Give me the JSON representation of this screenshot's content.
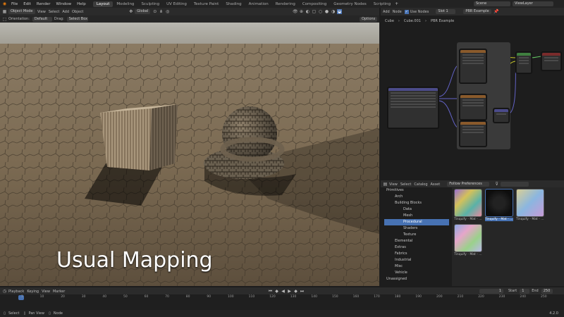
{
  "menu": [
    "File",
    "Edit",
    "Render",
    "Window",
    "Help"
  ],
  "workspaces": [
    "Layout",
    "Modeling",
    "Sculpting",
    "UV Editing",
    "Texture Paint",
    "Shading",
    "Animation",
    "Rendering",
    "Compositing",
    "Geometry Nodes",
    "Scripting"
  ],
  "active_workspace": "Layout",
  "scene_name": "Scene",
  "view_layer": "ViewLayer",
  "viewport": {
    "mode": "Object Mode",
    "menus": [
      "View",
      "Select",
      "Add",
      "Object"
    ],
    "transform": "Global",
    "orientation_label": "Orientation:",
    "orientation_value": "Default",
    "drag_label": "Drag:",
    "drag_value": "Select Box",
    "options": "Options",
    "caption": "Usual Mapping"
  },
  "node_editor": {
    "menus": [
      "Add",
      "Node"
    ],
    "use_nodes": "Use Nodes",
    "slot": "Slot 1",
    "material": "PBR Example",
    "breadcrumb": [
      "Cube",
      "Cube.001",
      "PBR Example"
    ]
  },
  "asset_browser": {
    "menus": [
      "View",
      "Select",
      "Catalog",
      "Asset"
    ],
    "import_method": "Follow Preferences",
    "tree": [
      "Primitives",
      "Arch",
      "Building Blocks",
      "Data",
      "Mesh",
      "Procedural",
      "Shaders",
      "Texture",
      "Elemental",
      "Extras",
      "Fabrics",
      "Industrial",
      "Misc",
      "Vehicle",
      "Unassigned"
    ],
    "selected": "Procedural",
    "assets": [
      "Tinquify - Mat - ...",
      "Tinquify - Mat - ...",
      "Tinquify - Mat - ...",
      "Tinquify - Mat - ..."
    ]
  },
  "timeline": {
    "menus": [
      "Playback",
      "Keying",
      "View",
      "Marker"
    ],
    "current_frame": "1",
    "start_label": "Start",
    "start": "1",
    "end_label": "End",
    "end": "250",
    "ticks": [
      "1",
      "10",
      "20",
      "30",
      "40",
      "50",
      "60",
      "70",
      "80",
      "90",
      "100",
      "110",
      "120",
      "130",
      "140",
      "150",
      "160",
      "170",
      "180",
      "190",
      "200",
      "210",
      "220",
      "230",
      "240",
      "250"
    ]
  },
  "status": {
    "items": [
      "Select",
      "Pan View",
      "Node"
    ],
    "version": "4.2.0"
  }
}
